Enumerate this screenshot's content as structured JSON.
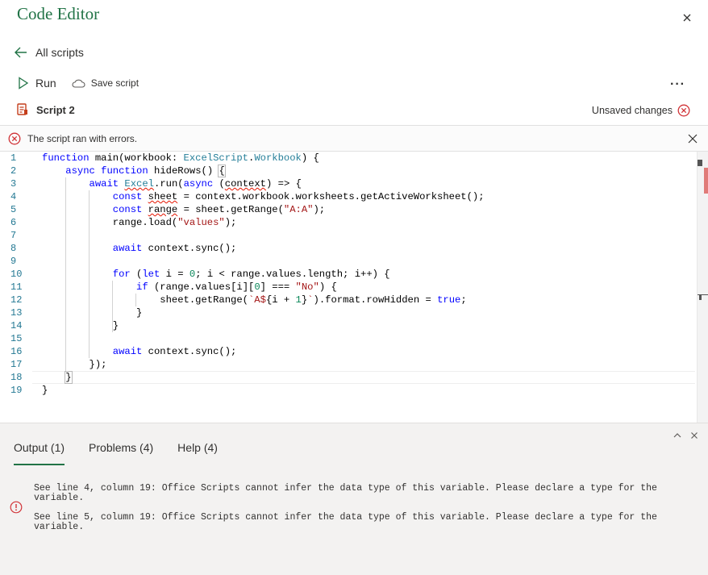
{
  "app": {
    "title": "Code Editor"
  },
  "nav": {
    "back_label": "All scripts"
  },
  "toolbar": {
    "run_label": "Run",
    "save_label": "Save script"
  },
  "script": {
    "name": "Script 2",
    "status": "Unsaved changes"
  },
  "error_bar": {
    "message": "The script ran with errors."
  },
  "editor": {
    "line_numbers": [
      "1",
      "2",
      "3",
      "4",
      "5",
      "6",
      "7",
      "8",
      "9",
      "10",
      "11",
      "12",
      "13",
      "14",
      "15",
      "16",
      "17",
      "18",
      "19"
    ]
  },
  "output_panel": {
    "tabs": [
      {
        "label": "Output (1)",
        "active": true
      },
      {
        "label": "Problems (4)",
        "active": false
      },
      {
        "label": "Help (4)",
        "active": false
      }
    ],
    "messages": [
      "See line 4, column 19: Office Scripts cannot infer the data type of this variable. Please declare a type for the variable.",
      "See line 5, column 19: Office Scripts cannot infer the data type of this variable. Please declare a type for the variable."
    ]
  },
  "colors": {
    "brand": "#217346",
    "error": "#d13438"
  }
}
